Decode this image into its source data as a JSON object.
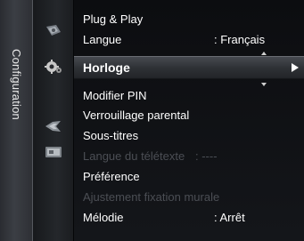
{
  "sidebar": {
    "title": "Configuration",
    "icons": [
      "sound-icon",
      "setup-icon",
      "input-icon",
      "support-icon"
    ]
  },
  "menu": {
    "items": [
      {
        "label": "Plug & Play",
        "value": "",
        "enabled": true
      },
      {
        "label": "Langue",
        "value": ": Français",
        "enabled": true
      },
      {
        "label": "Horloge",
        "value": "",
        "enabled": true,
        "selected": true
      },
      {
        "label": "Modifier PIN",
        "value": "",
        "enabled": true
      },
      {
        "label": "Verrouillage parental",
        "value": "",
        "enabled": true
      },
      {
        "label": "Sous-titres",
        "value": "",
        "enabled": true
      },
      {
        "label": "Langue du télétexte",
        "value": ": ----",
        "enabled": false
      },
      {
        "label": "Préférence",
        "value": "",
        "enabled": true
      },
      {
        "label": "Ajustement fixation murale",
        "value": "",
        "enabled": false
      },
      {
        "label": "Mélodie",
        "value": ": Arrêt",
        "enabled": true
      }
    ]
  },
  "colors": {
    "text": "#ffffff",
    "disabled_text": "#4b4e54",
    "highlight": "#3a3d42",
    "background": "#050608"
  }
}
